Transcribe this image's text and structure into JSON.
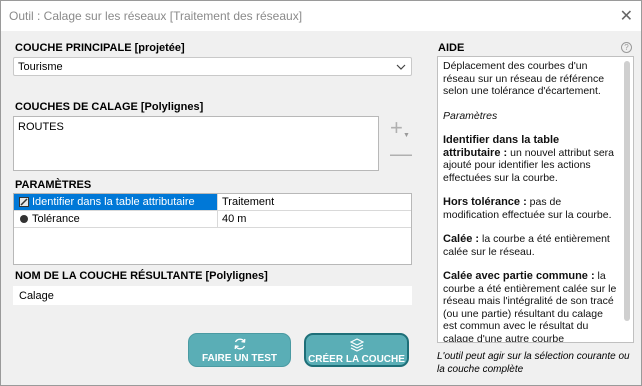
{
  "window": {
    "title": "Outil : Calage sur les réseaux [Traitement des réseaux]",
    "close_glyph": "✕"
  },
  "main_layer": {
    "label": "COUCHE PRINCIPALE [projetée]",
    "selected": "Tourisme"
  },
  "calage_layers": {
    "label": "COUCHES DE CALAGE [Polylignes]",
    "items": [
      "ROUTES"
    ],
    "add_glyph": "+",
    "add_arrow_glyph": "▼",
    "remove_glyph": "—"
  },
  "parameters": {
    "label": "PARAMÈTRES",
    "rows": [
      {
        "name": "Identifier dans la table attributaire",
        "value": "Traitement",
        "selected": true
      },
      {
        "name": "Tolérance",
        "value": "40 m",
        "selected": false
      }
    ]
  },
  "result_layer": {
    "label": "NOM DE LA COUCHE RÉSULTANTE [Polylignes]",
    "value": "Calage"
  },
  "buttons": {
    "test": "FAIRE UN TEST",
    "create": "CRÉER LA COUCHE"
  },
  "aide": {
    "label": "AIDE",
    "help_glyph": "?",
    "intro": "Déplacement des courbes d'un réseau sur un réseau de référence selon une tolérance d'écartement.",
    "params_title": "Paramètres",
    "p1_head": "Identifier dans la table attributaire :",
    "p1_body": " un nouvel attribut sera ajouté pour identifier les actions effectuées sur la courbe.",
    "p2_head": "Hors tolérance :",
    "p2_body": " pas de modification effectuée sur la courbe.",
    "p3_head": "Calée :",
    "p3_body": " la courbe a été entièrement calée sur le réseau.",
    "p4_head": "Calée avec partie commune :",
    "p4_body": " la courbe a été entièrement calée sur le réseau mais l'intégralité de son tracé (ou une partie) résultant du calage est commun avec le résultat du calage d'une autre courbe (entièrement ou une partie)."
  },
  "footer_note": "L'outil peut agir sur la sélection courante ou la couche complète"
}
